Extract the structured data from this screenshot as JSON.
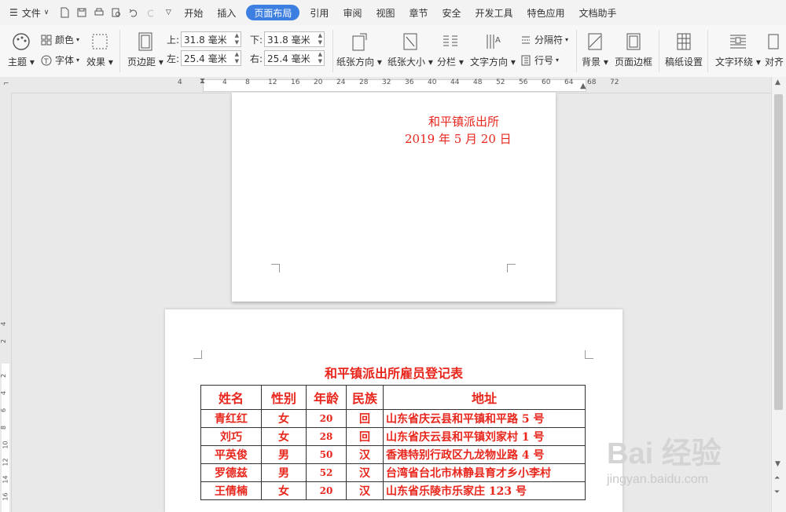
{
  "menu": {
    "file": "文件",
    "tabs": [
      "开始",
      "插入",
      "页面布局",
      "引用",
      "审阅",
      "视图",
      "章节",
      "安全",
      "开发工具",
      "特色应用",
      "文档助手"
    ]
  },
  "ribbon": {
    "theme": "主题",
    "color": "颜色",
    "font": "字体",
    "effect": "效果",
    "margins": "页边距",
    "top_label": "上:",
    "top_value": "31.8 毫米",
    "bottom_label": "下:",
    "bottom_value": "31.8 毫米",
    "left_label": "左:",
    "left_value": "25.4 毫米",
    "right_label": "右:",
    "right_value": "25.4 毫米",
    "orientation": "纸张方向",
    "size": "纸张大小",
    "columns": "分栏",
    "text_direction": "文字方向",
    "breaks": "分隔符",
    "line_numbers": "行号",
    "background": "背景",
    "page_border": "页面边框",
    "manuscript": "稿纸设置",
    "text_wrap": "文字环绕",
    "align": "对齐"
  },
  "ruler": {
    "ticks": [
      "4",
      "4",
      "8",
      "12",
      "16",
      "20",
      "24",
      "28",
      "32",
      "36",
      "40",
      "44",
      "48",
      "52",
      "56",
      "60",
      "64",
      "68",
      "72"
    ]
  },
  "vruler": {
    "ticks": [
      "4",
      "2",
      "2",
      "4",
      "6",
      "8",
      "10",
      "12",
      "14",
      "16"
    ]
  },
  "page1": {
    "sig_org": "和平镇派出所",
    "sig_date": "2019 年 5 月 20 日"
  },
  "page2": {
    "title": "和平镇派出所雇员登记表",
    "headers": [
      "姓名",
      "性别",
      "年龄",
      "民族",
      "地址"
    ],
    "rows": [
      [
        "青红红",
        "女",
        "20",
        "回",
        "山东省庆云县和平镇和平路 5 号"
      ],
      [
        "刘巧",
        "女",
        "28",
        "回",
        "山东省庆云县和平镇刘家村 1 号"
      ],
      [
        "平英俊",
        "男",
        "50",
        "汉",
        "香港特别行政区九龙物业路 4 号"
      ],
      [
        "罗德兹",
        "男",
        "52",
        "汉",
        "台湾省台北市林静县育才乡小李村"
      ],
      [
        "王倩楠",
        "女",
        "20",
        "汉",
        "山东省乐陵市乐家庄 123 号"
      ]
    ]
  },
  "watermark": {
    "brand": "Bai 经验",
    "url": "jingyan.baidu.com"
  }
}
